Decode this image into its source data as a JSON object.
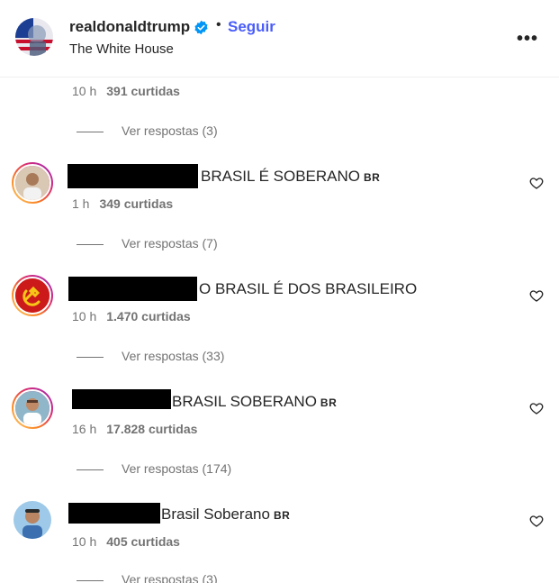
{
  "header": {
    "username": "realdonaldtrump",
    "separator": "•",
    "follow_label": "Seguir",
    "subtitle": "The White House",
    "more_icon": "more-options-icon"
  },
  "top_comment": {
    "time": "10 h",
    "likes": "391 curtidas",
    "replies": "Ver respostas (3)"
  },
  "comments": [
    {
      "text": "BRASIL É SOBERANO",
      "flag": "BR",
      "time": "1 h",
      "likes": "349 curtidas",
      "replies": "Ver respostas (7)"
    },
    {
      "text": "O BRASIL É DOS BRASILEIRO",
      "flag": "",
      "time": "10 h",
      "likes": "1.470 curtidas",
      "replies": "Ver respostas (33)"
    },
    {
      "text": "BRASIL SOBERANO",
      "flag": "BR",
      "time": "16 h",
      "likes": "17.828 curtidas",
      "replies": "Ver respostas (174)"
    },
    {
      "text": "Brasil Soberano",
      "flag": "BR",
      "time": "10 h",
      "likes": "405 curtidas",
      "replies": "Ver respostas (3)"
    }
  ],
  "colors": {
    "link": "#4a5df9",
    "muted": "#737373",
    "text": "#262626",
    "verified": "#0095f6"
  }
}
